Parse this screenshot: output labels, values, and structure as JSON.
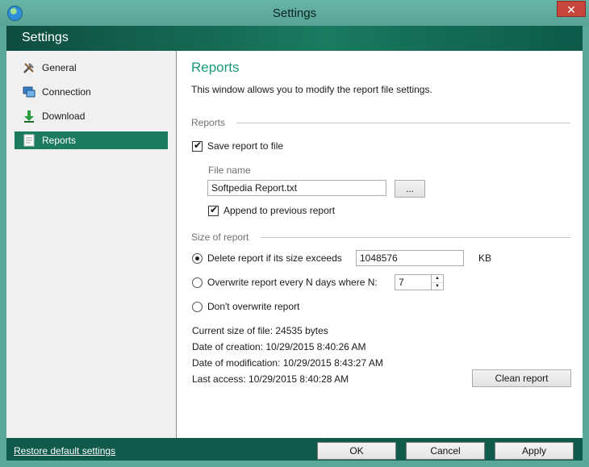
{
  "window": {
    "title": "Settings",
    "close_glyph": "✕"
  },
  "header": {
    "title": "Settings"
  },
  "sidebar": {
    "items": [
      {
        "label": "General",
        "icon": "tools-icon"
      },
      {
        "label": "Connection",
        "icon": "network-icon"
      },
      {
        "label": "Download",
        "icon": "download-arrow-icon"
      },
      {
        "label": "Reports",
        "icon": "document-icon",
        "active": true
      }
    ]
  },
  "main": {
    "title": "Reports",
    "description": "This window allows you to modify the report file settings.",
    "reports_section": "Reports",
    "save_report_label": "Save report to file",
    "file_name_label": "File name",
    "file_name_value": "Softpedia Report.txt",
    "browse_label": "...",
    "append_label": "Append to previous report",
    "size_section": "Size of report",
    "delete_label": "Delete report if its size exceeds",
    "delete_value": "1048576",
    "kb_unit": "KB",
    "overwrite_label": "Overwrite report every N days where N:",
    "overwrite_value": "7",
    "dont_overwrite_label": "Don't overwrite report",
    "current_size": "Current size of file: 24535 bytes",
    "creation_date": "Date of creation: 10/29/2015 8:40:26 AM",
    "modification_date": "Date of modification: 10/29/2015 8:43:27 AM",
    "last_access": "Last access: 10/29/2015 8:40:28 AM",
    "clean_report_label": "Clean report"
  },
  "footer": {
    "restore_label": "Restore default settings",
    "ok_label": "OK",
    "cancel_label": "Cancel",
    "apply_label": "Apply"
  },
  "colors": {
    "accent": "#1a9a7d",
    "header_dark": "#0e4d40",
    "active_nav": "#1c7a5e"
  }
}
